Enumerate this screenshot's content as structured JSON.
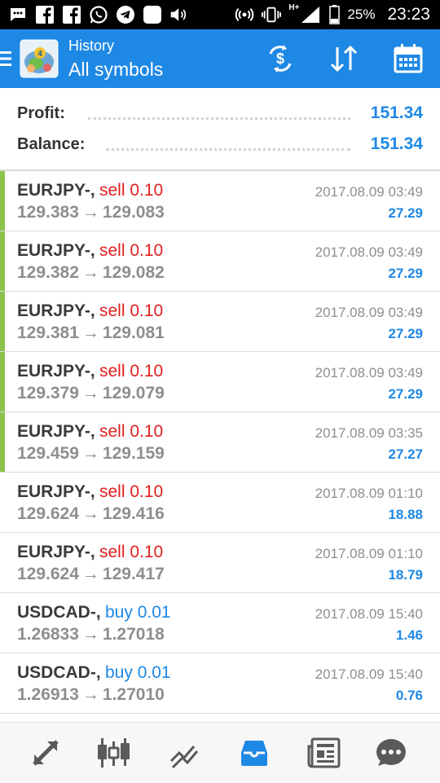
{
  "status_bar": {
    "battery_percent": "25%",
    "time": "23:23",
    "network_badge": "H+",
    "icons": [
      "chat-icon",
      "facebook-icon",
      "facebook-icon",
      "whatsapp-icon",
      "telegram-icon",
      "app-icon",
      "speaker-icon",
      "hotspot-icon",
      "vibrate-icon",
      "signal-icon",
      "battery-icon"
    ]
  },
  "header": {
    "subtitle": "History",
    "title": "All symbols",
    "icons": [
      "menu-icon",
      "app-logo",
      "currency-exchange-icon",
      "sort-icon",
      "calendar-icon"
    ],
    "accent_color": "#1e88e5"
  },
  "summary": {
    "profit_label": "Profit:",
    "profit_value": "151.34",
    "balance_label": "Balance:",
    "balance_value": "151.34"
  },
  "deals": [
    {
      "symbol": "EURJPY-,",
      "side": "sell 0.10",
      "direction": "sell",
      "open": "129.383",
      "close": "129.083",
      "time": "2017.08.09 03:49",
      "profit": "27.29",
      "highlighted": true
    },
    {
      "symbol": "EURJPY-,",
      "side": "sell 0.10",
      "direction": "sell",
      "open": "129.382",
      "close": "129.082",
      "time": "2017.08.09 03:49",
      "profit": "27.29",
      "highlighted": true
    },
    {
      "symbol": "EURJPY-,",
      "side": "sell 0.10",
      "direction": "sell",
      "open": "129.381",
      "close": "129.081",
      "time": "2017.08.09 03:49",
      "profit": "27.29",
      "highlighted": true
    },
    {
      "symbol": "EURJPY-,",
      "side": "sell 0.10",
      "direction": "sell",
      "open": "129.379",
      "close": "129.079",
      "time": "2017.08.09 03:49",
      "profit": "27.29",
      "highlighted": true
    },
    {
      "symbol": "EURJPY-,",
      "side": "sell 0.10",
      "direction": "sell",
      "open": "129.459",
      "close": "129.159",
      "time": "2017.08.09 03:35",
      "profit": "27.27",
      "highlighted": true
    },
    {
      "symbol": "EURJPY-,",
      "side": "sell 0.10",
      "direction": "sell",
      "open": "129.624",
      "close": "129.416",
      "time": "2017.08.09 01:10",
      "profit": "18.88",
      "highlighted": false
    },
    {
      "symbol": "EURJPY-,",
      "side": "sell 0.10",
      "direction": "sell",
      "open": "129.624",
      "close": "129.417",
      "time": "2017.08.09 01:10",
      "profit": "18.79",
      "highlighted": false
    },
    {
      "symbol": "USDCAD-,",
      "side": "buy 0.01",
      "direction": "buy",
      "open": "1.26833",
      "close": "1.27018",
      "time": "2017.08.09 15:40",
      "profit": "1.46",
      "highlighted": false
    },
    {
      "symbol": "USDCAD-,",
      "side": "buy 0.01",
      "direction": "buy",
      "open": "1.26913",
      "close": "1.27010",
      "time": "2017.08.09 15:40",
      "profit": "0.76",
      "highlighted": false
    }
  ],
  "arrow_glyph": "→",
  "colors": {
    "sell": "#e02020",
    "buy": "#1e88e5",
    "profit": "#1e88e5",
    "marker": "#8bc34a",
    "nav_active": "#1e88e5",
    "nav_inactive": "#5a5a5a"
  },
  "bottom_nav": {
    "items": [
      "quotes-icon",
      "charts-icon",
      "trade-icon",
      "history-icon",
      "news-icon",
      "chat-icon"
    ],
    "active": "history-icon"
  }
}
